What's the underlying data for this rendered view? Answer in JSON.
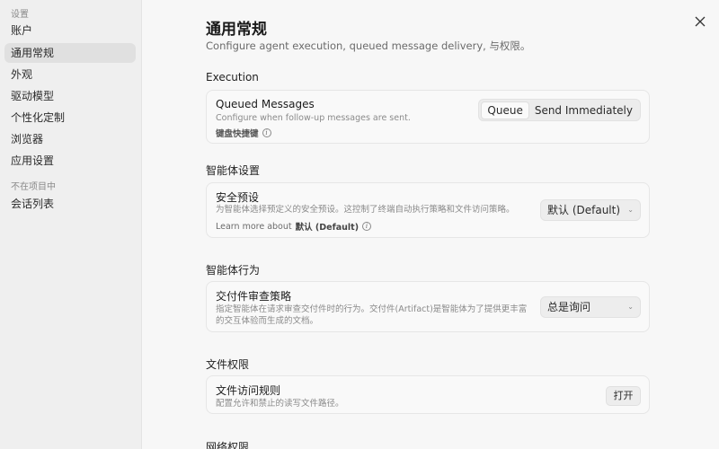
{
  "sidebar": {
    "section_settings": "设置",
    "items": [
      {
        "label": "账户"
      },
      {
        "label": "通用常规"
      },
      {
        "label": "外观"
      },
      {
        "label": "驱动模型"
      },
      {
        "label": "个性化定制"
      },
      {
        "label": "浏览器"
      },
      {
        "label": "应用设置"
      }
    ],
    "section_other": "不在项目中",
    "other_items": [
      {
        "label": "会话列表"
      }
    ],
    "active_index": 1
  },
  "header": {
    "title": "通用常规",
    "subtitle": "Configure agent execution, queued message delivery, 与权限。"
  },
  "sections": {
    "execution": {
      "title": "Execution",
      "card": {
        "title": "Queued Messages",
        "desc": "Configure when follow-up messages are sent.",
        "meta": "键盘快捷键",
        "options": [
          "Queue",
          "Send Immediately"
        ],
        "selected": "Queue"
      }
    },
    "agent_settings": {
      "title": "智能体设置",
      "card": {
        "title": "安全预设",
        "desc": "为智能体选择预定义的安全预设。这控制了终端自动执行策略和文件访问策略。",
        "meta_prefix": "Learn more about",
        "meta_bold": "默认 (Default)",
        "dropdown_value": "默认 (Default)"
      }
    },
    "agent_behavior": {
      "title": "智能体行为",
      "card": {
        "title": "交付件审查策略",
        "desc_line1": "指定智能体在请求审查交付件时的行为。交付件(Artifact)是智能体为了提供更丰富",
        "desc_line2": "的交互体验而生成的文档。",
        "dropdown_value": "总是询问"
      }
    },
    "file_permissions": {
      "title": "文件权限",
      "card": {
        "title": "文件访问规则",
        "desc": "配置允许和禁止的读写文件路径。",
        "button": "打开"
      }
    },
    "network_permissions": {
      "title": "网络权限"
    }
  },
  "icons": {
    "close": "close-icon",
    "info": "info-icon",
    "chevron": "chevron-down-icon"
  }
}
